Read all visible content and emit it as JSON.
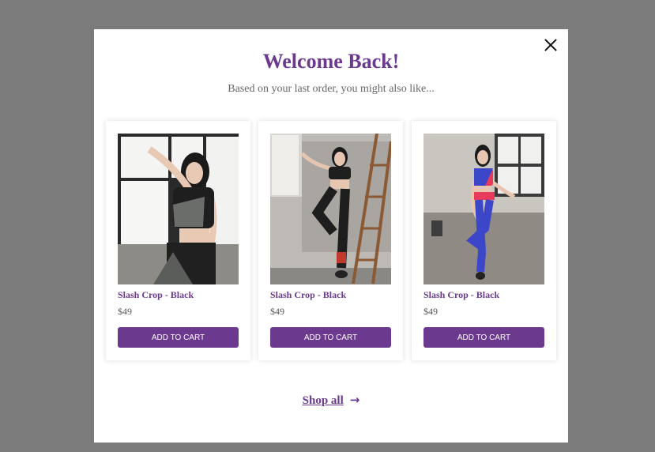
{
  "modal": {
    "title": "Welcome Back!",
    "subtitle": "Based on your last order, you might also like...",
    "close_icon": "close-icon"
  },
  "products": [
    {
      "name": "Slash Crop - Black",
      "price": "$49",
      "button": "ADD TO CART",
      "image": "model-black-gray-set"
    },
    {
      "name": "Slash Crop - Black",
      "price": "$49",
      "button": "ADD TO CART",
      "image": "model-black-set-ladder"
    },
    {
      "name": "Slash Crop - Black",
      "price": "$49",
      "button": "ADD TO CART",
      "image": "model-blue-red-set"
    }
  ],
  "footer": {
    "shop_all": "Shop all",
    "arrow_icon": "arrow-right-icon"
  },
  "colors": {
    "accent": "#6b3a8e",
    "overlay": "#7b7b7b"
  }
}
